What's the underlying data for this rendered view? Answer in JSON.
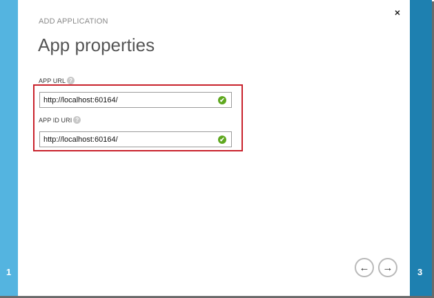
{
  "wizard": {
    "left_step": "1",
    "right_step": "3",
    "close_label": "×",
    "subtitle": "ADD APPLICATION",
    "title": "App properties"
  },
  "fields": [
    {
      "label": "APP URL",
      "help": "?",
      "value": "http://localhost:60164/",
      "valid": "✔"
    },
    {
      "label": "APP ID URI",
      "help": "?",
      "value": "http://localhost:60164/",
      "valid": "✔"
    }
  ],
  "nav": {
    "back_label": "←",
    "next_label": "→"
  },
  "colors": {
    "left_strip": "#54b4e0",
    "right_strip": "#1e80b0",
    "highlight": "#c8202a",
    "valid": "#5fa81f"
  }
}
